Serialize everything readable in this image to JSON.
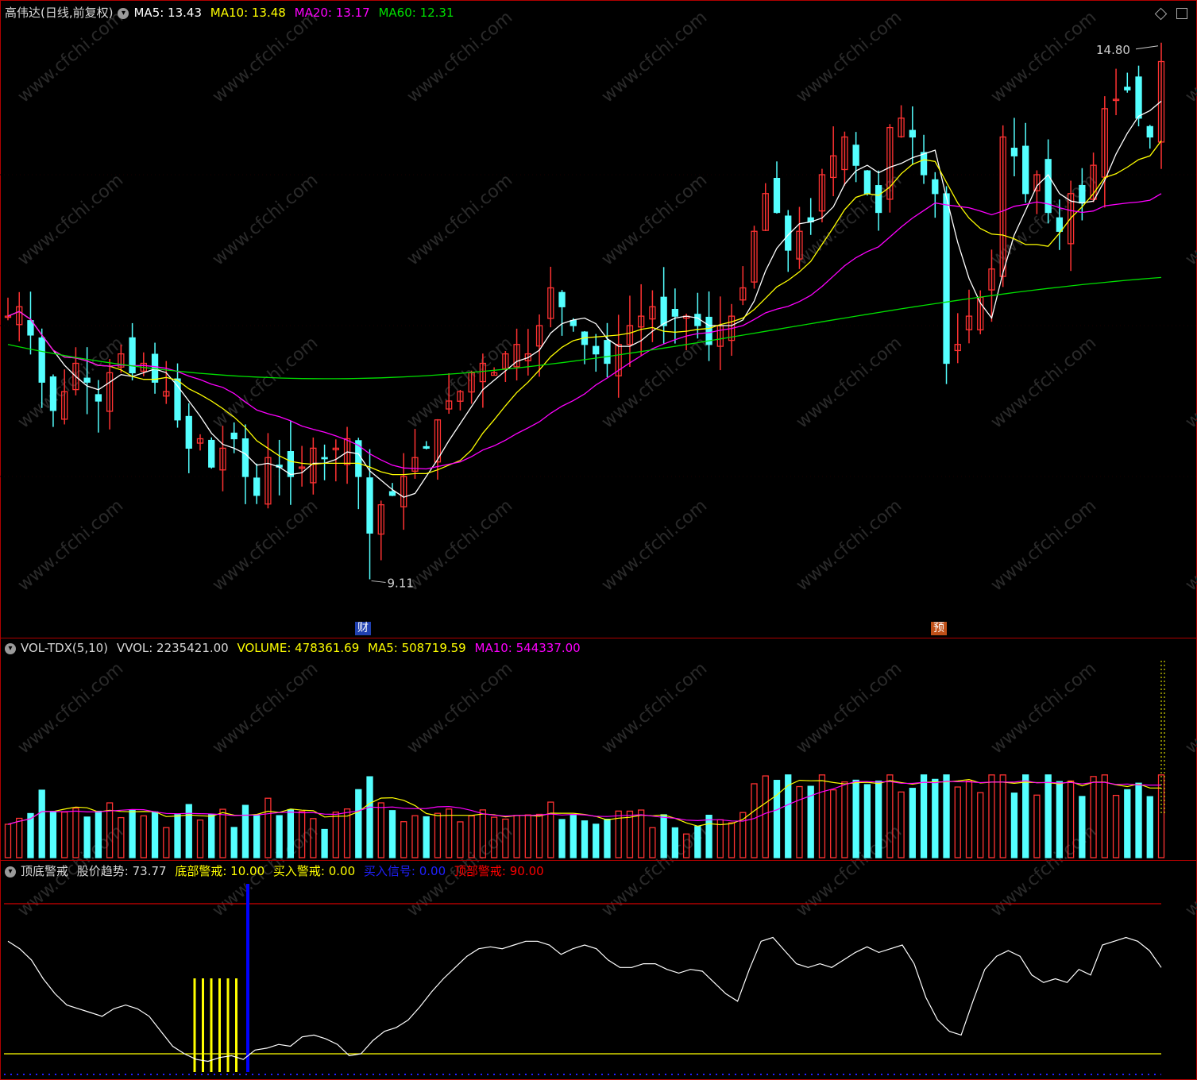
{
  "header": {
    "title": "高伟达(日线,前复权)",
    "ma5": "MA5: 13.43",
    "ma10": "MA10: 13.48",
    "ma20": "MA20: 13.17",
    "ma60": "MA60: 12.31"
  },
  "annotations": {
    "high": "14.80",
    "low": "9.11",
    "marker_cai": "财",
    "marker_yu": "预"
  },
  "volume_panel": {
    "name": "VOL-TDX(5,10)",
    "vvol": "VVOL: 2235421.00",
    "volume": "VOLUME: 478361.69",
    "ma5": "MA5: 508719.59",
    "ma10": "MA10: 544337.00"
  },
  "indicator_panel": {
    "name": "顶底警戒",
    "trend": "股价趋势: 73.77",
    "bottom_alert": "底部警戒: 10.00",
    "buy_alert": "买入警戒: 0.00",
    "buy_signal": "买入信号: 0.00",
    "top_alert": "顶部警戒: 90.00"
  },
  "colors": {
    "up": "#ff3232",
    "down": "#54ffff",
    "ma5": "#ffffff",
    "ma10": "#ffff00",
    "ma20": "#ff00ff",
    "ma60": "#00e000",
    "buy_signal": "#0000ff",
    "top_alert": "#ff0000"
  },
  "chart_data": [
    {
      "type": "candlestick",
      "title": "高伟达(日线,前复权)",
      "ylim": [
        8.6,
        15.0
      ],
      "annotated_high": 14.8,
      "annotated_low": 9.11,
      "close_series": [
        11.9,
        12.0,
        11.7,
        11.2,
        10.9,
        11.1,
        11.4,
        11.2,
        11.0,
        11.3,
        11.5,
        11.3,
        11.4,
        11.2,
        11.1,
        10.8,
        10.5,
        10.6,
        10.3,
        10.5,
        10.6,
        10.2,
        10.0,
        10.4,
        10.3,
        10.2,
        10.3,
        10.5,
        10.4,
        10.5,
        10.6,
        10.2,
        9.6,
        9.9,
        10.0,
        10.2,
        10.4,
        10.5,
        10.8,
        11.0,
        11.1,
        11.3,
        11.4,
        11.3,
        11.5,
        11.6,
        11.5,
        11.8,
        12.2,
        12.0,
        11.8,
        11.6,
        11.5,
        11.4,
        11.6,
        11.8,
        11.9,
        12.0,
        11.8,
        11.9,
        11.9,
        11.8,
        11.6,
        11.8,
        11.9,
        12.2,
        12.8,
        13.2,
        13.0,
        12.6,
        12.8,
        12.9,
        13.4,
        13.6,
        13.8,
        13.5,
        13.2,
        13.0,
        13.9,
        14.0,
        13.8,
        13.4,
        13.2,
        11.4,
        11.6,
        11.9,
        12.1,
        12.4,
        13.8,
        13.6,
        13.2,
        13.4,
        13.0,
        12.8,
        13.2,
        13.1,
        13.5,
        14.1,
        14.2,
        14.3,
        14.0,
        13.8,
        14.6
      ],
      "ma60": "rising from 11.6 to 12.31",
      "series": [
        {
          "name": "MA5",
          "last": 13.43
        },
        {
          "name": "MA10",
          "last": 13.48
        },
        {
          "name": "MA20",
          "last": 13.17
        },
        {
          "name": "MA60",
          "last": 12.31
        }
      ]
    },
    {
      "type": "bar",
      "title": "VOL-TDX(5,10)",
      "series": [
        {
          "name": "VOLUME",
          "last": 478361.69
        },
        {
          "name": "MA5",
          "last": 508719.59
        },
        {
          "name": "MA10",
          "last": 544337.0
        }
      ],
      "vvol": 2235421.0
    },
    {
      "type": "line",
      "title": "顶底警戒",
      "ylim": [
        0,
        100
      ],
      "levels": {
        "top_alert": 90.0,
        "bottom_alert": 10.0
      },
      "trend_values": [
        70,
        66,
        60,
        50,
        42,
        36,
        34,
        32,
        30,
        34,
        36,
        34,
        30,
        22,
        14,
        10,
        7,
        6,
        8,
        9,
        7,
        12,
        13,
        15,
        14,
        19,
        20,
        18,
        15,
        9,
        10,
        17,
        22,
        24,
        28,
        35,
        43,
        50,
        56,
        62,
        66,
        67,
        66,
        68,
        70,
        70,
        68,
        63,
        66,
        68,
        66,
        60,
        56,
        56,
        58,
        58,
        55,
        53,
        55,
        54,
        48,
        42,
        38,
        55,
        70,
        72,
        65,
        58,
        56,
        58,
        56,
        60,
        64,
        67,
        64,
        66,
        68,
        58,
        40,
        28,
        22,
        20,
        38,
        55,
        62,
        65,
        62,
        52,
        48,
        50,
        48,
        55,
        52,
        68,
        70,
        72,
        70,
        65,
        56
      ]
    }
  ]
}
